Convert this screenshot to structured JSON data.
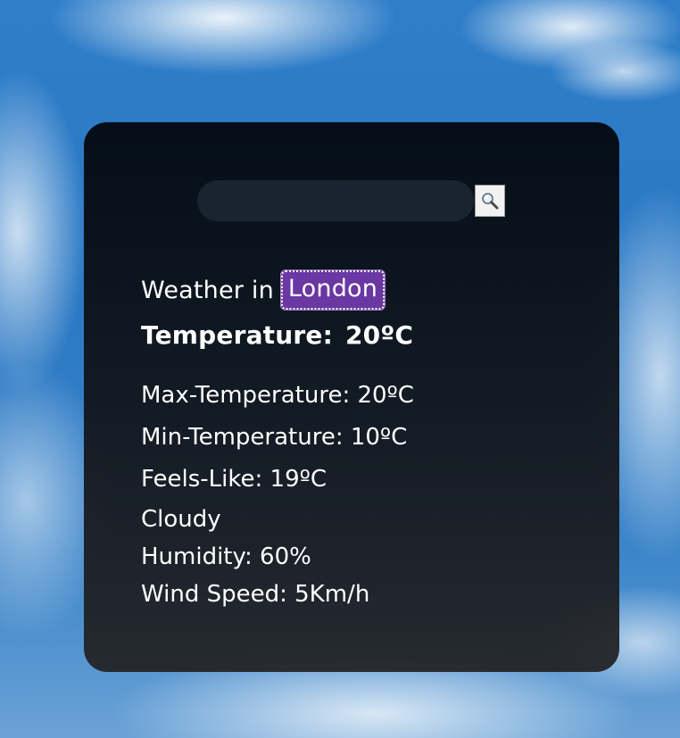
{
  "search": {
    "placeholder": "",
    "value": "",
    "button_icon": "magnifier-icon"
  },
  "weather": {
    "prefix": "Weather in",
    "city": "London",
    "temperature_label": "Temperature:",
    "temperature_value": "20ºC",
    "max_temperature": "Max-Temperature: 20ºC",
    "min_temperature": "Min-Temperature: 10ºC",
    "feels_like": "Feels-Like: 19ºC",
    "condition": "Cloudy",
    "humidity": "Humidity: 60%",
    "wind_speed": "Wind Speed: 5Km/h"
  },
  "colors": {
    "card_background": "#05101a",
    "city_badge": "#6a37a3",
    "sky": "#2f7ec9",
    "text": "#ffffff"
  }
}
